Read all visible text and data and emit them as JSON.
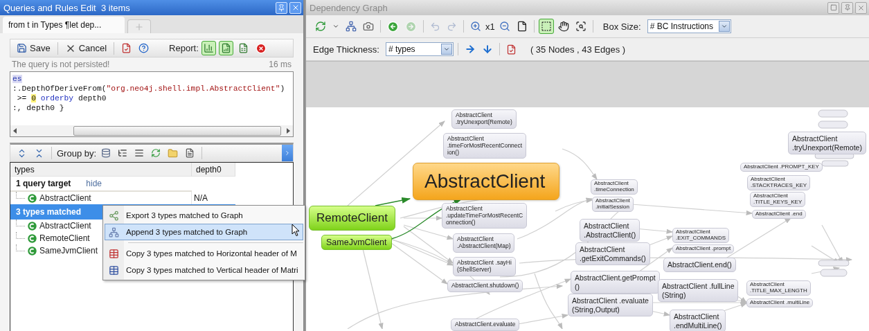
{
  "left_panel": {
    "title": "Queries and Rules Edit  3 items",
    "tabs": [
      {
        "label": "from t in Types ¶let dep...",
        "selected": true
      }
    ],
    "toolbar": {
      "save": "Save",
      "cancel": "Cancel",
      "report_label": "Report:",
      "report_toggles": [
        {
          "selected": true
        },
        {
          "selected": true
        },
        {
          "selected": false
        }
      ]
    },
    "status": {
      "message": "The query is not persisted!",
      "duration": "16 ms"
    },
    "code_lines": [
      [
        {
          "kind": "selection",
          "text": "es"
        }
      ],
      [
        {
          "kind": "plain",
          "text": ":.DepthOfDeriveFrom("
        },
        {
          "kind": "string",
          "text": "\"org.neo4j.shell.impl.AbstractClient\""
        },
        {
          "kind": "plain",
          "text": ")"
        }
      ],
      [
        {
          "kind": "plain",
          "text": " >= "
        },
        {
          "kind": "number",
          "text": "0"
        },
        {
          "kind": "keyword",
          "text": " orderby"
        },
        {
          "kind": "plain",
          "text": " depth0"
        }
      ],
      [
        {
          "kind": "plain",
          "text": ":, depth0 }"
        }
      ]
    ],
    "results_toolbar": {
      "group_by_label": "Group by:"
    },
    "table": {
      "columns": [
        "types",
        "depth0"
      ],
      "groups": [
        {
          "label": "1 query target",
          "link": "hide",
          "selected": false,
          "rows": [
            {
              "name": "AbstractClient",
              "depth0": "N/A"
            }
          ]
        },
        {
          "label": "3 types matched",
          "selected": true,
          "rows": [
            {
              "name": "AbstractClient"
            },
            {
              "name": "RemoteClient"
            },
            {
              "name": "SameJvmClient"
            }
          ]
        }
      ]
    },
    "context_menu": {
      "sections": [
        [
          {
            "kind": "export",
            "label": "Export 3 types matched to Graph",
            "selected": false
          },
          {
            "kind": "append",
            "label": "Append 3 types matched to Graph",
            "selected": true
          }
        ],
        [
          {
            "kind": "copy-horizontal",
            "label": "Copy 3 types matched to Horizontal header of M",
            "selected": false
          },
          {
            "kind": "copy-vertical",
            "label": "Copy 3 types matched to Vertical header of Matri",
            "selected": false
          }
        ]
      ]
    }
  },
  "graph_panel": {
    "title": "Dependency Graph",
    "history": [
      {
        "disabled": false
      },
      {
        "disabled": true
      }
    ],
    "edit_history": [
      {
        "disabled": true
      },
      {
        "disabled": true
      }
    ],
    "zoom_label": "x1",
    "tools": [
      {
        "selected": true
      },
      {
        "selected": false
      },
      {
        "selected": false
      }
    ],
    "box_size": {
      "label": "Box Size:",
      "value": "# BC Instructions"
    },
    "edge_thickness": {
      "label": "Edge Thickness:",
      "value": "# types"
    },
    "summary": "( 35 Nodes , 43 Edges )",
    "nodes": [
      {
        "kind": "method",
        "text": "AbstractClient\n.tryUnexport(Remote)"
      },
      {
        "kind": "method",
        "text": "AbstractClient\n.timeForMostRecentConnect\nion()"
      },
      {
        "kind": "main",
        "text": "AbstractClient"
      },
      {
        "kind": "match",
        "text": "RemoteClient"
      },
      {
        "kind": "submatch",
        "text": "SameJvmClient"
      },
      {
        "kind": "method",
        "text": "AbstractClient\n.updateTimeForMostRecentC\nonnection()"
      },
      {
        "kind": "method",
        "text": "AbstractClient\n.AbstractClient(Map)"
      },
      {
        "kind": "method",
        "text": "AbstractClient .sayHi\n(ShellServer)"
      },
      {
        "kind": "method",
        "text": "AbstractClient.shutdown()"
      },
      {
        "kind": "method",
        "text": "AbstractClient.evaluate"
      },
      {
        "kind": "small",
        "text": "AbstractClient\n.timeConnection"
      },
      {
        "kind": "small",
        "text": "AbstractClient\n.initialSession"
      },
      {
        "kind": "large",
        "text": "AbstractClient\n.AbstractClient()"
      },
      {
        "kind": "large",
        "text": "AbstractClient\n.getExitCommands()"
      },
      {
        "kind": "large",
        "text": "AbstractClient.getPrompt\n()"
      },
      {
        "kind": "large",
        "text": "AbstractClient .evaluate\n(String,Output)"
      },
      {
        "kind": "small",
        "text": "AbstractClient\n.EXIT_COMMANDS"
      },
      {
        "kind": "small",
        "text": "AbstractClient .prompt"
      },
      {
        "kind": "large",
        "text": "AbstractClient.end()"
      },
      {
        "kind": "large",
        "text": "AbstractClient .fullLine\n(String)"
      },
      {
        "kind": "large",
        "text": "AbstractClient\n.endMultiLine()"
      },
      {
        "kind": "small",
        "text": "AbstractClient .PROMPT_KEY"
      },
      {
        "kind": "small",
        "text": "AbstractClient\n.STACKTRACES_KEY"
      },
      {
        "kind": "small",
        "text": "AbstractClient\n.TITLE_KEYS_KEY"
      },
      {
        "kind": "small",
        "text": "AbstractClient .end"
      },
      {
        "kind": "small",
        "text": "AbstractClient\n.TITLE_MAX_LENGTH"
      },
      {
        "kind": "small",
        "text": "AbstractClient .multiLine"
      },
      {
        "kind": "large",
        "text": "AbstractClient\n.tryUnexport(Remote)"
      }
    ]
  }
}
